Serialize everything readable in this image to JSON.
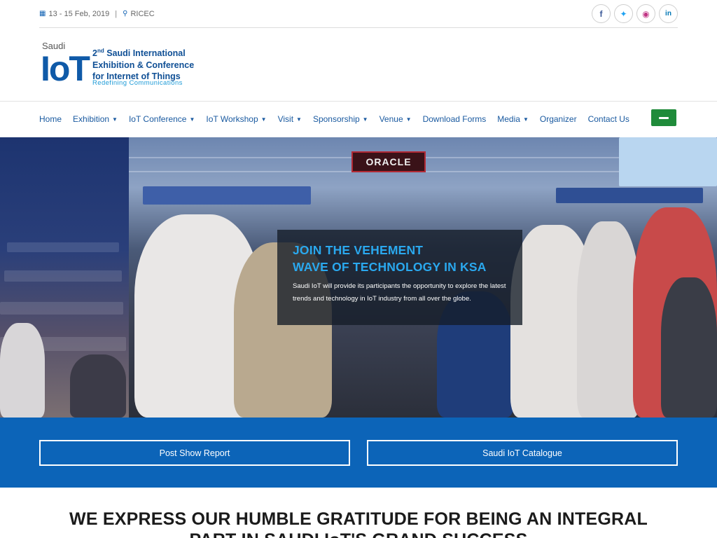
{
  "topbar": {
    "date": "13 - 15 Feb, 2019",
    "separator": "|",
    "venue": "RICEC",
    "calendar_icon": "calendar-icon",
    "location_icon": "map-marker-icon",
    "socials": [
      {
        "name": "facebook-icon",
        "glyph": "f",
        "color": "#3b5998"
      },
      {
        "name": "twitter-icon",
        "glyph": "t",
        "color": "#1da1f2"
      },
      {
        "name": "instagram-icon",
        "glyph": "◎",
        "color": "#c13584"
      },
      {
        "name": "linkedin-icon",
        "glyph": "in",
        "color": "#0077b5"
      }
    ]
  },
  "logo": {
    "saudi": "Saudi",
    "iot": "IoT",
    "line1_prefix": "2",
    "line1_sup": "nd",
    "line1_rest": " Saudi International",
    "line2": "Exhibition & Conference",
    "line3": "for Internet of Things",
    "tagline": "Redefining Communications"
  },
  "nav": {
    "items": [
      {
        "label": "Home",
        "dropdown": false
      },
      {
        "label": "Exhibition",
        "dropdown": true
      },
      {
        "label": "IoT Conference",
        "dropdown": true
      },
      {
        "label": "IoT Workshop",
        "dropdown": true
      },
      {
        "label": "Visit",
        "dropdown": true
      },
      {
        "label": "Sponsorship",
        "dropdown": true
      },
      {
        "label": "Venue",
        "dropdown": true
      },
      {
        "label": "Download Forms",
        "dropdown": false
      },
      {
        "label": "Media",
        "dropdown": true
      },
      {
        "label": "Organizer",
        "dropdown": false
      },
      {
        "label": "Contact Us",
        "dropdown": false
      }
    ],
    "caret": "▼"
  },
  "hero": {
    "title_line1": "JOIN THE VEHEMENT",
    "title_line2": "WAVE OF TECHNOLOGY IN KSA",
    "description": "Saudi IoT will provide its participants the opportunity to explore the latest trends and technology in IoT industry from all over the globe.",
    "booth_sign": "ORACLE"
  },
  "band": {
    "left_button": "Post Show Report",
    "right_button": "Saudi IoT Catalogue"
  },
  "gratitude": {
    "line1": "WE EXPRESS OUR HUMBLE GRATITUDE FOR BEING AN INTEGRAL",
    "line2": "PART IN SAUDI IoT'S GRAND SUCCESS"
  },
  "colors": {
    "brand_blue": "#0c64b8",
    "accent_cyan": "#2aa8ee",
    "nav_text": "#1a5aa0"
  }
}
